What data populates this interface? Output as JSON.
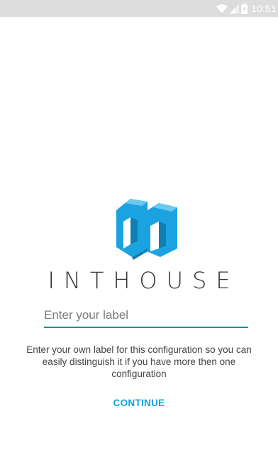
{
  "status_bar": {
    "time": "10:51",
    "icons": [
      "wifi-icon",
      "signal-icon",
      "battery-icon"
    ]
  },
  "brand": {
    "name": "INTHOUSE",
    "logo": "inthouse-logo",
    "color": "#1aa3e0"
  },
  "label_form": {
    "value": "",
    "placeholder": "Enter your label",
    "helper": "Enter your own label for this configuration so you can easily distinguish it if you have more then one configuration",
    "accent": "#009688"
  },
  "actions": {
    "continue_label": "CONTINUE",
    "color": "#14a3dc"
  }
}
